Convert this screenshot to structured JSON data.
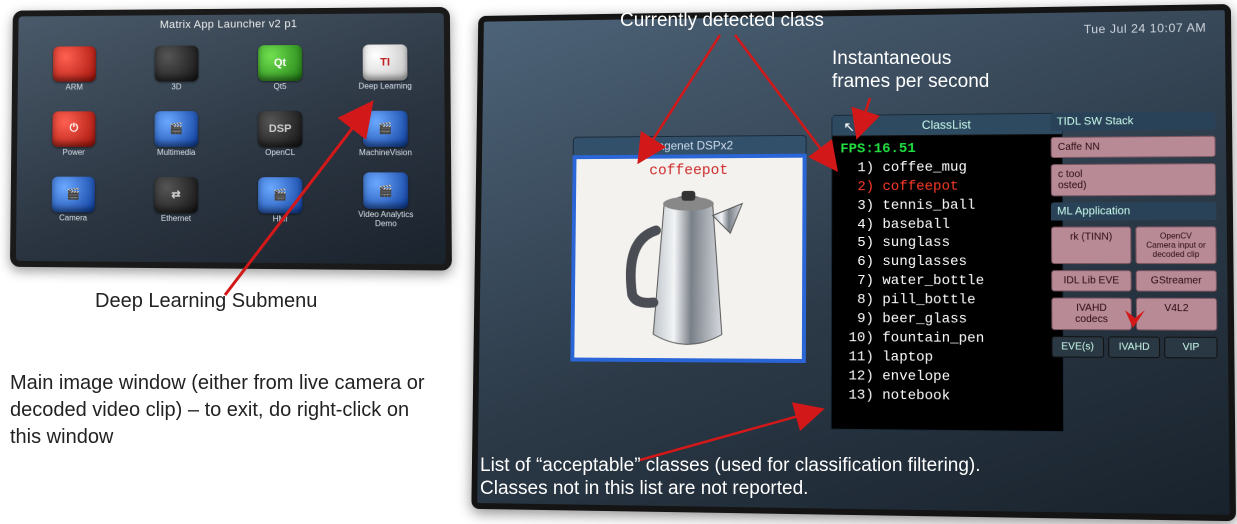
{
  "launcher": {
    "title": "Matrix App Launcher v2 p1",
    "apps": [
      {
        "label": "ARM",
        "glyph": "",
        "cls": "c-red"
      },
      {
        "label": "3D",
        "glyph": "",
        "cls": "c-dark"
      },
      {
        "label": "Qt5",
        "glyph": "Qt",
        "cls": "c-green"
      },
      {
        "label": "Deep Learning",
        "glyph": "TI",
        "cls": "c-white"
      },
      {
        "label": "Power",
        "glyph": "⏻",
        "cls": "c-red"
      },
      {
        "label": "Multimedia",
        "glyph": "🎬",
        "cls": "c-blue"
      },
      {
        "label": "OpenCL",
        "glyph": "DSP",
        "cls": "c-dark"
      },
      {
        "label": "MachineVision",
        "glyph": "🎬",
        "cls": "c-blue"
      },
      {
        "label": "Camera",
        "glyph": "🎬",
        "cls": "c-blue"
      },
      {
        "label": "Ethernet",
        "glyph": "⇄",
        "cls": "c-dark"
      },
      {
        "label": "HMI",
        "glyph": "🎬",
        "cls": "c-blue"
      },
      {
        "label": "Video Analytics Demo",
        "glyph": "🎬",
        "cls": "c-blue"
      }
    ]
  },
  "captions": {
    "deep_learning_submenu": "Deep Learning  Submenu",
    "main_window": "Main image window (either from live camera or decoded video clip) – to exit, do right-click on this window",
    "detected_class": "Currently  detected  class",
    "fps_label": "Instantaneous\nframes per second",
    "acceptable": "List of “acceptable” classes (used for classification filtering).\nClasses not in this list are not reported."
  },
  "demo": {
    "clock": "Tue Jul 24  10:07 AM",
    "imgwin_title": "Imagenet  DSPx2",
    "img_caption": "coffeepot",
    "classwin_title": "ClassList",
    "fps": "FPS:16.51",
    "classes": [
      {
        "idx": "1)",
        "name": "coffee_mug"
      },
      {
        "idx": "2)",
        "name": "coffeepot",
        "hl": true
      },
      {
        "idx": "3)",
        "name": "tennis_ball"
      },
      {
        "idx": "4)",
        "name": "baseball"
      },
      {
        "idx": "5)",
        "name": "sunglass"
      },
      {
        "idx": "6)",
        "name": "sunglasses"
      },
      {
        "idx": "7)",
        "name": "water_bottle"
      },
      {
        "idx": "8)",
        "name": "pill_bottle"
      },
      {
        "idx": "9)",
        "name": "beer_glass"
      },
      {
        "idx": "10)",
        "name": "fountain_pen"
      },
      {
        "idx": "11)",
        "name": "laptop"
      },
      {
        "idx": "12)",
        "name": "envelope"
      },
      {
        "idx": "13)",
        "name": "notebook"
      }
    ],
    "rightcol": {
      "hdr1": "TIDL SW Stack",
      "blk1": "Caffe NN",
      "blk2": "c tool\nosted)",
      "hdr2": "ML Application",
      "row1": [
        "rk (TINN)",
        "OpenCV\nCamera input or decoded clip"
      ],
      "row2": [
        "IDL Lib EVE",
        "GStreamer"
      ],
      "row3": [
        "IVAHD\ncodecs",
        "V4L2"
      ],
      "row4": [
        "EVE(s)",
        "IVAHD",
        "VIP"
      ]
    }
  }
}
